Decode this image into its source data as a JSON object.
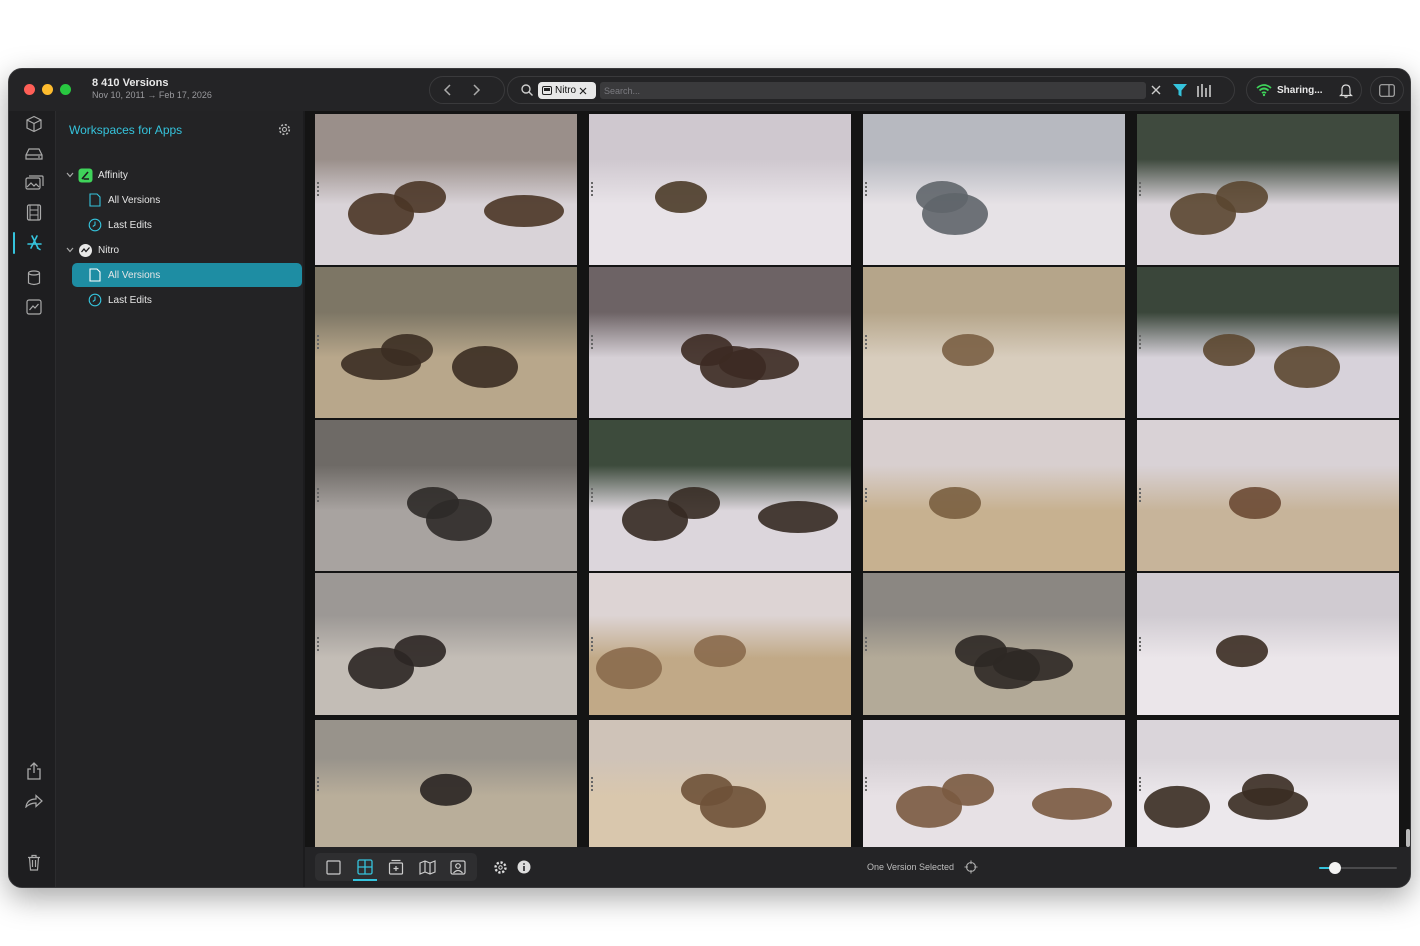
{
  "window": {
    "title": "8 410 Versions",
    "date_range": "Nov 10, 2011 → Feb 17, 2026"
  },
  "search": {
    "token_label": "Nitro",
    "placeholder": "Search..."
  },
  "sharing": {
    "label": "Sharing..."
  },
  "sidebar": {
    "workspace_title": "Workspaces for Apps",
    "groups": [
      {
        "name": "Affinity",
        "items": [
          {
            "label": "All Versions"
          },
          {
            "label": "Last Edits"
          }
        ]
      },
      {
        "name": "Nitro",
        "items": [
          {
            "label": "All Versions",
            "selected": true
          },
          {
            "label": "Last Edits"
          }
        ]
      }
    ]
  },
  "grid": {
    "columns": 4,
    "rows_visible": 5,
    "thumbnails": [
      "bison-snow",
      "bison-herd-snow",
      "river-mountains",
      "bison-forest",
      "moose-grass",
      "bison-line",
      "moose-antlers-grass",
      "bison-slope",
      "moose-closeup",
      "bison-forest-edge",
      "elk-meadow",
      "elk-grazing",
      "moose-pair",
      "elk-herd",
      "moose-bull",
      "bison-group",
      "moose-bull-2",
      "elk-bull-grazing",
      "elk-herd-hillside",
      "bison-closeup"
    ]
  },
  "status": {
    "text": "One Version Selected"
  },
  "zoom_slider": {
    "value": 0.2
  },
  "colors": {
    "accent": "#35c3dc",
    "selected_bg": "#1e8da3",
    "window_bg": "#1c1c1e"
  }
}
